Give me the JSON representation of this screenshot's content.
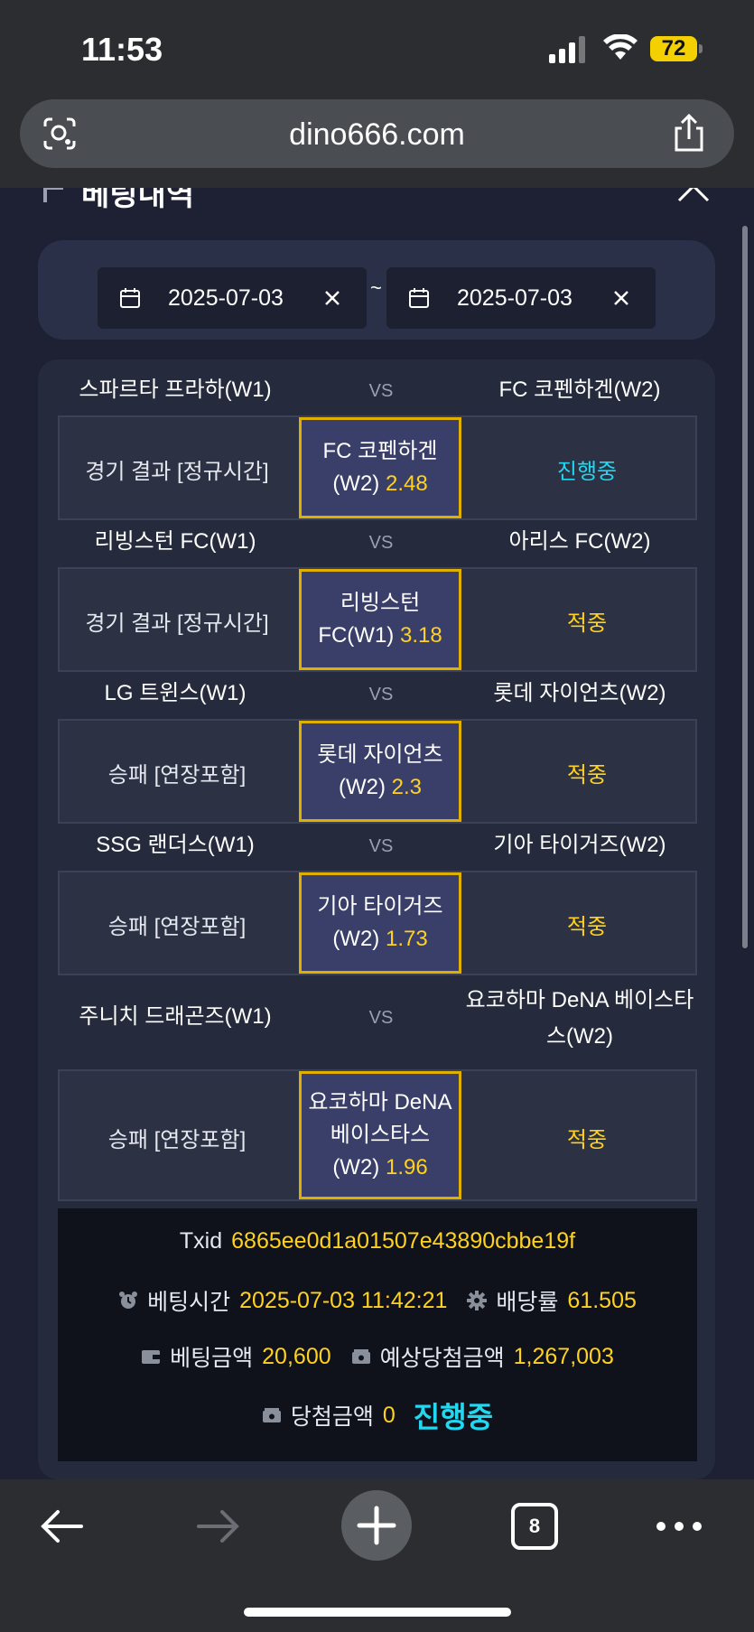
{
  "status_bar": {
    "time": "11:53",
    "battery": "72"
  },
  "browser": {
    "url": "dino666.com",
    "tab_count": "8"
  },
  "section": {
    "title": "베팅내역"
  },
  "date_filter": {
    "from": "2025-07-03",
    "to": "2025-07-03",
    "separator": "~"
  },
  "vs_label": "VS",
  "bets": [
    {
      "home": "스파르타 프라하(W1)",
      "away": "FC 코펜하겐(W2)",
      "market": "경기 결과 [정규시간]",
      "pick": "FC 코펜하겐(W2)",
      "odds": "2.48",
      "result": "진행중",
      "result_type": "live"
    },
    {
      "home": "리빙스턴 FC(W1)",
      "away": "아리스 FC(W2)",
      "market": "경기 결과 [정규시간]",
      "pick": "리빙스턴 FC(W1)",
      "odds": "3.18",
      "result": "적중",
      "result_type": "win"
    },
    {
      "home": "LG 트윈스(W1)",
      "away": "롯데 자이언츠(W2)",
      "market": "승패 [연장포함]",
      "pick": "롯데 자이언츠(W2)",
      "odds": "2.3",
      "result": "적중",
      "result_type": "win"
    },
    {
      "home": "SSG 랜더스(W1)",
      "away": "기아 타이거즈(W2)",
      "market": "승패 [연장포함]",
      "pick": "기아 타이거즈(W2)",
      "odds": "1.73",
      "result": "적중",
      "result_type": "win"
    },
    {
      "home": "주니치 드래곤즈(W1)",
      "away": "요코하마 DeNA 베이스타스(W2)",
      "market": "승패 [연장포함]",
      "pick": "요코하마 DeNA 베이스타스(W2)",
      "odds": "1.96",
      "result": "적중",
      "result_type": "win"
    }
  ],
  "summary": {
    "txid_label": "Txid",
    "txid": "6865ee0d1a01507e43890cbbe19f",
    "bet_time_label": "베팅시간",
    "bet_time": "2025-07-03 11:42:21",
    "odds_label": "배당률",
    "odds": "61.505",
    "bet_amount_label": "베팅금액",
    "bet_amount": "20,600",
    "expected_label": "예상당첨금액",
    "expected": "1,267,003",
    "win_amount_label": "당첨금액",
    "win_amount": "0",
    "status": "진행중"
  },
  "colors": {
    "accent_yellow": "#ffd21f",
    "accent_cyan": "#22d8f0",
    "card_bg": "#252a3c"
  }
}
